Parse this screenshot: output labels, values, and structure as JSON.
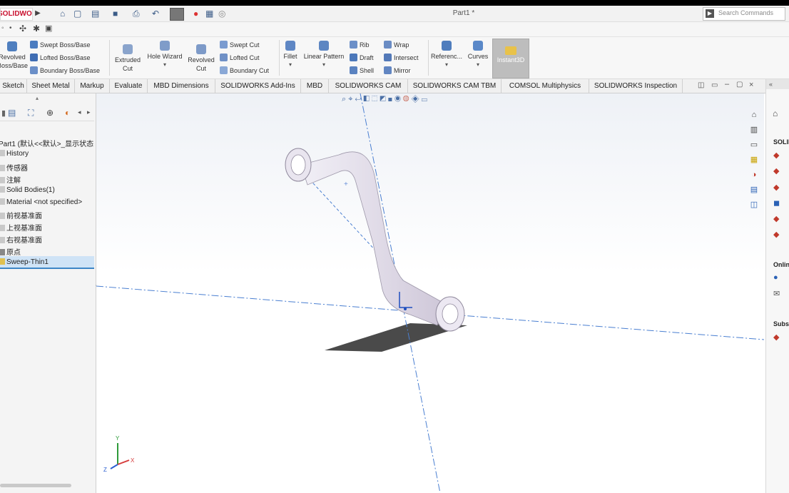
{
  "title_bar": {
    "logo_text": "SOLIDWORKS",
    "document_title": "Part1 *",
    "search_placeholder": "Search Commands"
  },
  "ribbon": {
    "revolved_boss_base": "Revolved\nBoss/Base",
    "swept_boss_base": "Swept Boss/Base",
    "lofted_boss_base": "Lofted Boss/Base",
    "boundary_boss_base": "Boundary Boss/Base",
    "extruded_cut": "Extruded\nCut",
    "hole_wizard": "Hole Wizard",
    "revolved_cut": "Revolved\nCut",
    "swept_cut": "Swept Cut",
    "lofted_cut": "Lofted Cut",
    "boundary_cut": "Boundary Cut",
    "fillet": "Fillet",
    "linear_pattern": "Linear Pattern",
    "rib": "Rib",
    "draft": "Draft",
    "shell": "Shell",
    "wrap": "Wrap",
    "intersect": "Intersect",
    "mirror": "Mirror",
    "reference": "Referenc...",
    "curves": "Curves",
    "instant3d": "Instant3D"
  },
  "tabs": [
    "Sketch",
    "Sheet Metal",
    "Markup",
    "Evaluate",
    "MBD Dimensions",
    "SOLIDWORKS Add-Ins",
    "MBD",
    "SOLIDWORKS CAM",
    "SOLIDWORKS CAM TBM",
    "COMSOL Multiphysics",
    "SOLIDWORKS Inspection"
  ],
  "feature_tree": {
    "root": "Part1 (默认<<默认>_显示状态",
    "items": [
      "History",
      "传感器",
      "注解",
      "Solid Bodies(1)",
      "Material <not specified>",
      "前视基准面",
      "上视基准面",
      "右视基准面",
      "原点",
      "Sweep-Thin1"
    ]
  },
  "right_panel": {
    "section1": "SOLIDWORKS",
    "section2": "Online",
    "section3": "Subscription"
  },
  "viewport": {
    "triad": {
      "x": "X",
      "y": "Y",
      "z": "Z"
    }
  },
  "colors": {
    "accent": "#1f6fc5",
    "logo_red": "#c8102e",
    "selection_bg": "#cfe3f6",
    "axis_blue": "#4a7fd1"
  }
}
